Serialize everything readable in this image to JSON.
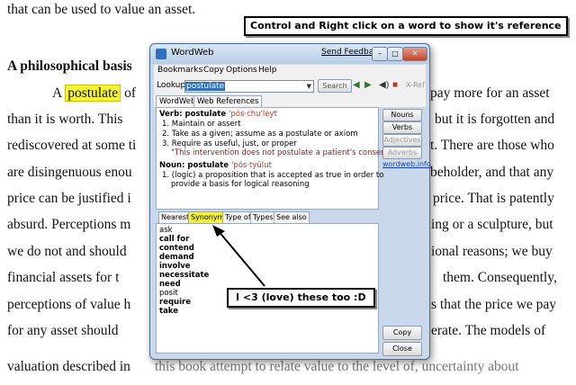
{
  "document": {
    "line1": "that can be used to value an asset.",
    "heading": "A philosophical basis",
    "line3_a": "A",
    "line3_word": "postulate",
    "line3_b": "of",
    "line3_right": "pay more for an asset",
    "line4_left": "than it is worth. This",
    "line4_right": "but it is forgotten and",
    "line5_left": "rediscovered at some ti",
    "line5_right": "t. There are those who",
    "line6_left": "are disingenuous enou",
    "line6_right": "beholder, and that any",
    "line7_left": "price can be justified i",
    "line7_right": "price. That is patently",
    "line8_left": "absurd. Perceptions m",
    "line8_right": "ing or a sculpture, but",
    "line9_left": "we do not and should",
    "line9_right": "ional reasons; we buy",
    "line10_left": "financial assets for t",
    "line10_right": "them. Consequently,",
    "line11_left": "perceptions of value h",
    "line11_right": "s that the price we pay",
    "line12_left": "for any asset should",
    "line12_right": "erate. The models of",
    "line13_left": "valuation described in",
    "line13_right": "this book attempt to relate value to the level of, uncertainty about"
  },
  "callouts": {
    "top": "Control and Right click on a word to show it's reference",
    "bottom": "I <3 (love) these too :D"
  },
  "window": {
    "title": "WordWeb",
    "send_feedback": "Send Feedback",
    "controls": {
      "minimize": "–",
      "maximize": "□",
      "close": "✕"
    }
  },
  "menu": [
    "Bookmarks",
    "Copy",
    "Options",
    "Help"
  ],
  "toolbar": {
    "lookup_label": "Lookup:",
    "lookup_value": "postulate",
    "search_label": "Search",
    "xref_label": "X-Ref"
  },
  "tabs": [
    "WordWeb",
    "Web References"
  ],
  "definitions": {
    "verb_header": "Verb: postulate",
    "verb_pron": "'pós·chu'leyt",
    "senses": [
      "1.  Maintain or assert",
      "2.  Take as a given; assume as a postulate or axiom",
      "3.  Require as useful, just, or proper"
    ],
    "example": "\"This intervention does not postulate a patient's consent\"",
    "noun_header": "Noun: postulate",
    "noun_pron": "'pós·tyûlut",
    "noun_sense_1": "1.  (logic) a proposition that is accepted as true in order to",
    "noun_sense_2": "provide a basis for logical reasoning"
  },
  "side_buttons": {
    "nouns": "Nouns",
    "verbs": "Verbs",
    "adjectives": "Adjectives",
    "adverbs": "Adverbs",
    "link": "wordweb.info"
  },
  "lower_tabs": [
    "Nearest",
    "Synonyms",
    "Type of",
    "Types",
    "See also"
  ],
  "synonyms": [
    {
      "text": "ask",
      "bold": false
    },
    {
      "text": "call for",
      "bold": true
    },
    {
      "text": "contend",
      "bold": true
    },
    {
      "text": "demand",
      "bold": true
    },
    {
      "text": "involve",
      "bold": true
    },
    {
      "text": "necessitate",
      "bold": true
    },
    {
      "text": "need",
      "bold": true
    },
    {
      "text": "posit",
      "bold": false
    },
    {
      "text": "require",
      "bold": true
    },
    {
      "text": "take",
      "bold": true
    }
  ],
  "bottom_buttons": {
    "copy": "Copy",
    "close": "Close"
  },
  "colors": {
    "highlight": "#f4f23a",
    "window_frame": "#c9d8ea",
    "link": "#1a3fbf",
    "pronunciation": "#c0392b"
  }
}
